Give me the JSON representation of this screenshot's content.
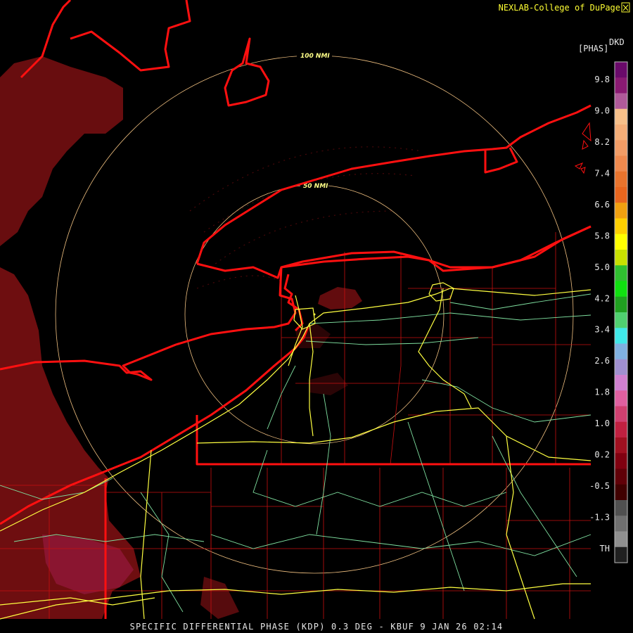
{
  "header": {
    "credit": "NEXLAB-College of DuPage",
    "logo_icon": "cod-logo-icon",
    "product_code": "DKD",
    "product_unit": "[PHAS]"
  },
  "range_rings": [
    {
      "label": "100 NMI",
      "radius_nmi": 100
    },
    {
      "label": "50 NMI",
      "radius_nmi": 50
    }
  ],
  "legend": {
    "ticks": [
      "9.8",
      "9.0",
      "8.2",
      "7.4",
      "6.6",
      "5.8",
      "5.0",
      "4.2",
      "3.4",
      "2.6",
      "1.8",
      "1.0",
      "0.2",
      "-0.5",
      "-1.3",
      "TH"
    ],
    "colors": [
      "#6a0a6a",
      "#8a1a72",
      "#b05a9a",
      "#f7c08a",
      "#f5ae78",
      "#f39d66",
      "#f08a4e",
      "#e9742d",
      "#e8661e",
      "#f0a010",
      "#ffd000",
      "#ffff00",
      "#c8e000",
      "#30c030",
      "#10e010",
      "#20a020",
      "#50d070",
      "#40e8e8",
      "#80b0e0",
      "#a090d0",
      "#d080d0",
      "#e060a0",
      "#d04070",
      "#c02040",
      "#a01020",
      "#800010",
      "#600008",
      "#400000",
      "#505050",
      "#707070",
      "#909090",
      "#202020"
    ]
  },
  "map_colors": {
    "background": "#000000",
    "coastline": "#ff1010",
    "county_lines": "#c81010",
    "highways": "#ffff40",
    "roads": "#7fe0a0",
    "range_rings": "#f0c080",
    "echo": "#7a0f12"
  },
  "caption": "SPECIFIC DIFFERENTIAL PHASE (KDP) 0.3 DEG - KBUF 9 JAN 26 02:14"
}
